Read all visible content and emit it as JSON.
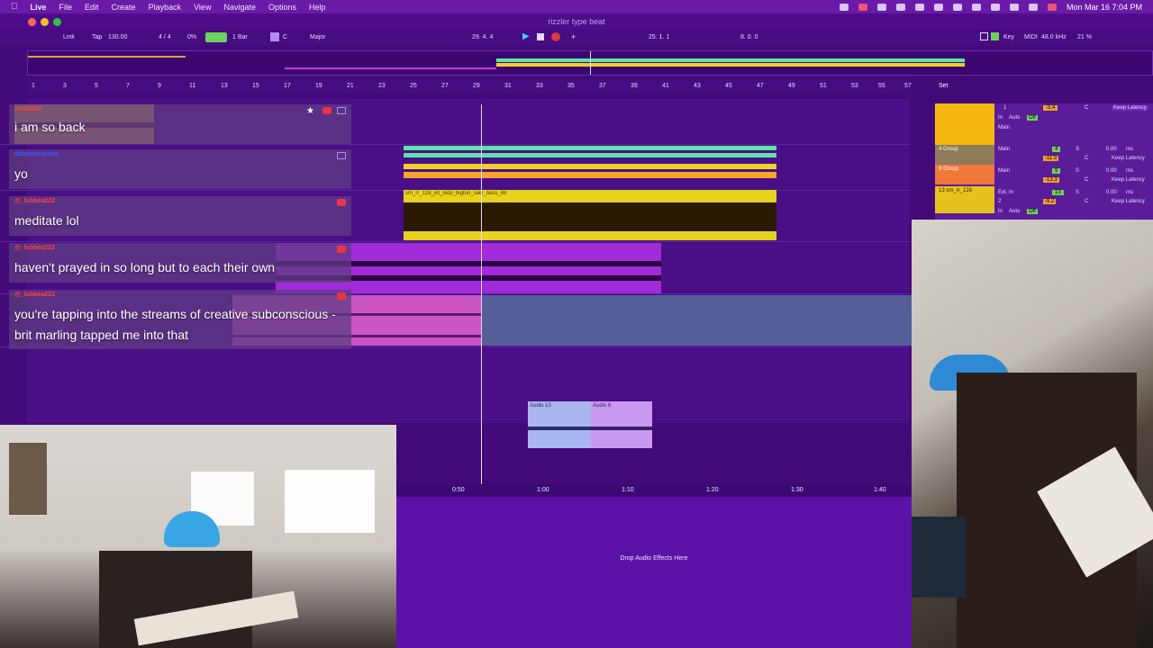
{
  "menubar": {
    "apple": "",
    "app": "Live",
    "items": [
      "File",
      "Edit",
      "Create",
      "Playback",
      "View",
      "Navigate",
      "Options",
      "Help"
    ],
    "datetime": "Mon Mar 16  7:04 PM"
  },
  "window": {
    "title": "rizzler type beat"
  },
  "transport": {
    "link": "Link",
    "tap": "Tap",
    "tempo": "130.00",
    "time_sig": "4 / 4",
    "cpu": "0%",
    "quantize": "1 Bar",
    "root": "C",
    "scale": "Major",
    "position": "29.  4.  4",
    "loop_start": "25.  1.  1",
    "loop_length": "8.  0.  0",
    "key": "Key",
    "midi": "MIDI",
    "sample_rate": "48.0 kHz",
    "zoom": "21 %"
  },
  "ruler": {
    "bars": [
      "1",
      "3",
      "5",
      "7",
      "9",
      "11",
      "13",
      "15",
      "17",
      "19",
      "21",
      "23",
      "25",
      "27",
      "29",
      "31",
      "33",
      "35",
      "37",
      "39",
      "41",
      "43",
      "45",
      "47",
      "49",
      "51",
      "53",
      "55",
      "57"
    ],
    "set_label": "Set"
  },
  "chat": [
    {
      "user": "zyzz4500",
      "message": "i am so back"
    },
    {
      "user": "dzhuwdcoulsa",
      "message": "yo"
    },
    {
      "user": "@_lubbea222",
      "message": "meditate lol"
    },
    {
      "user": "@_lubbea222",
      "message": "haven't prayed in so long but to each their own"
    },
    {
      "user": "@_lubbea222",
      "message": "you're tapping into the streams of creative subconscious - brit marling tapped me into that"
    }
  ],
  "clips": {
    "loop_name": "sm_rr_128_kit_loop_bigfun_saw_bass_88",
    "audio_10": "Audio 10",
    "audio_6": "Audio 6"
  },
  "mixer": {
    "rows": [
      {
        "name": "1",
        "route": "Main",
        "db": "-5.4",
        "pan": "C",
        "latency": "Keep Latency"
      },
      {
        "name": "4 Group",
        "route": "Main",
        "num": "4",
        "db": "-11.9",
        "pan": "C",
        "vol": "0.00",
        "unit": "ms",
        "latency": "Keep Latency"
      },
      {
        "name": "9 Group",
        "route": "Main",
        "num": "9",
        "db": "-13.3",
        "pan": "C",
        "vol": "0.00",
        "unit": "ms",
        "latency": "Keep Latency"
      },
      {
        "name": "13 sm_rr_128",
        "route": "Ext. In",
        "num": "13",
        "sub": "2",
        "db": "-9.2",
        "pan": "C",
        "vol": "0.00",
        "unit": "ms",
        "latency": "Keep Latency"
      }
    ],
    "in_label": "In",
    "auto_label": "Auto",
    "off_label": "Off",
    "main": "Main",
    "solo": "S"
  },
  "timebar": {
    "ticks": [
      "0:50",
      "1:00",
      "1:10",
      "1:20",
      "1:30",
      "1:40"
    ]
  },
  "detail": {
    "drop_hint": "Drop Audio Effects Here"
  },
  "colors": {
    "bg": "#420a78",
    "accent_green": "#7ae07a",
    "clip_yellow": "#e6d31e",
    "clip_purple": "#a12bd9",
    "clip_pink": "#cc55c6"
  }
}
